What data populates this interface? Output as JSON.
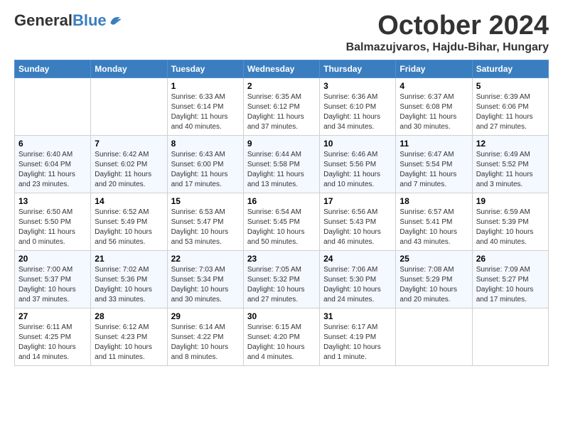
{
  "header": {
    "logo_general": "General",
    "logo_blue": "Blue",
    "title": "October 2024",
    "subtitle": "Balmazujvaros, Hajdu-Bihar, Hungary"
  },
  "weekdays": [
    "Sunday",
    "Monday",
    "Tuesday",
    "Wednesday",
    "Thursday",
    "Friday",
    "Saturday"
  ],
  "weeks": [
    [
      {
        "day": "",
        "info": ""
      },
      {
        "day": "",
        "info": ""
      },
      {
        "day": "1",
        "info": "Sunrise: 6:33 AM\nSunset: 6:14 PM\nDaylight: 11 hours and 40 minutes."
      },
      {
        "day": "2",
        "info": "Sunrise: 6:35 AM\nSunset: 6:12 PM\nDaylight: 11 hours and 37 minutes."
      },
      {
        "day": "3",
        "info": "Sunrise: 6:36 AM\nSunset: 6:10 PM\nDaylight: 11 hours and 34 minutes."
      },
      {
        "day": "4",
        "info": "Sunrise: 6:37 AM\nSunset: 6:08 PM\nDaylight: 11 hours and 30 minutes."
      },
      {
        "day": "5",
        "info": "Sunrise: 6:39 AM\nSunset: 6:06 PM\nDaylight: 11 hours and 27 minutes."
      }
    ],
    [
      {
        "day": "6",
        "info": "Sunrise: 6:40 AM\nSunset: 6:04 PM\nDaylight: 11 hours and 23 minutes."
      },
      {
        "day": "7",
        "info": "Sunrise: 6:42 AM\nSunset: 6:02 PM\nDaylight: 11 hours and 20 minutes."
      },
      {
        "day": "8",
        "info": "Sunrise: 6:43 AM\nSunset: 6:00 PM\nDaylight: 11 hours and 17 minutes."
      },
      {
        "day": "9",
        "info": "Sunrise: 6:44 AM\nSunset: 5:58 PM\nDaylight: 11 hours and 13 minutes."
      },
      {
        "day": "10",
        "info": "Sunrise: 6:46 AM\nSunset: 5:56 PM\nDaylight: 11 hours and 10 minutes."
      },
      {
        "day": "11",
        "info": "Sunrise: 6:47 AM\nSunset: 5:54 PM\nDaylight: 11 hours and 7 minutes."
      },
      {
        "day": "12",
        "info": "Sunrise: 6:49 AM\nSunset: 5:52 PM\nDaylight: 11 hours and 3 minutes."
      }
    ],
    [
      {
        "day": "13",
        "info": "Sunrise: 6:50 AM\nSunset: 5:50 PM\nDaylight: 11 hours and 0 minutes."
      },
      {
        "day": "14",
        "info": "Sunrise: 6:52 AM\nSunset: 5:49 PM\nDaylight: 10 hours and 56 minutes."
      },
      {
        "day": "15",
        "info": "Sunrise: 6:53 AM\nSunset: 5:47 PM\nDaylight: 10 hours and 53 minutes."
      },
      {
        "day": "16",
        "info": "Sunrise: 6:54 AM\nSunset: 5:45 PM\nDaylight: 10 hours and 50 minutes."
      },
      {
        "day": "17",
        "info": "Sunrise: 6:56 AM\nSunset: 5:43 PM\nDaylight: 10 hours and 46 minutes."
      },
      {
        "day": "18",
        "info": "Sunrise: 6:57 AM\nSunset: 5:41 PM\nDaylight: 10 hours and 43 minutes."
      },
      {
        "day": "19",
        "info": "Sunrise: 6:59 AM\nSunset: 5:39 PM\nDaylight: 10 hours and 40 minutes."
      }
    ],
    [
      {
        "day": "20",
        "info": "Sunrise: 7:00 AM\nSunset: 5:37 PM\nDaylight: 10 hours and 37 minutes."
      },
      {
        "day": "21",
        "info": "Sunrise: 7:02 AM\nSunset: 5:36 PM\nDaylight: 10 hours and 33 minutes."
      },
      {
        "day": "22",
        "info": "Sunrise: 7:03 AM\nSunset: 5:34 PM\nDaylight: 10 hours and 30 minutes."
      },
      {
        "day": "23",
        "info": "Sunrise: 7:05 AM\nSunset: 5:32 PM\nDaylight: 10 hours and 27 minutes."
      },
      {
        "day": "24",
        "info": "Sunrise: 7:06 AM\nSunset: 5:30 PM\nDaylight: 10 hours and 24 minutes."
      },
      {
        "day": "25",
        "info": "Sunrise: 7:08 AM\nSunset: 5:29 PM\nDaylight: 10 hours and 20 minutes."
      },
      {
        "day": "26",
        "info": "Sunrise: 7:09 AM\nSunset: 5:27 PM\nDaylight: 10 hours and 17 minutes."
      }
    ],
    [
      {
        "day": "27",
        "info": "Sunrise: 6:11 AM\nSunset: 4:25 PM\nDaylight: 10 hours and 14 minutes."
      },
      {
        "day": "28",
        "info": "Sunrise: 6:12 AM\nSunset: 4:23 PM\nDaylight: 10 hours and 11 minutes."
      },
      {
        "day": "29",
        "info": "Sunrise: 6:14 AM\nSunset: 4:22 PM\nDaylight: 10 hours and 8 minutes."
      },
      {
        "day": "30",
        "info": "Sunrise: 6:15 AM\nSunset: 4:20 PM\nDaylight: 10 hours and 4 minutes."
      },
      {
        "day": "31",
        "info": "Sunrise: 6:17 AM\nSunset: 4:19 PM\nDaylight: 10 hours and 1 minute."
      },
      {
        "day": "",
        "info": ""
      },
      {
        "day": "",
        "info": ""
      }
    ]
  ]
}
